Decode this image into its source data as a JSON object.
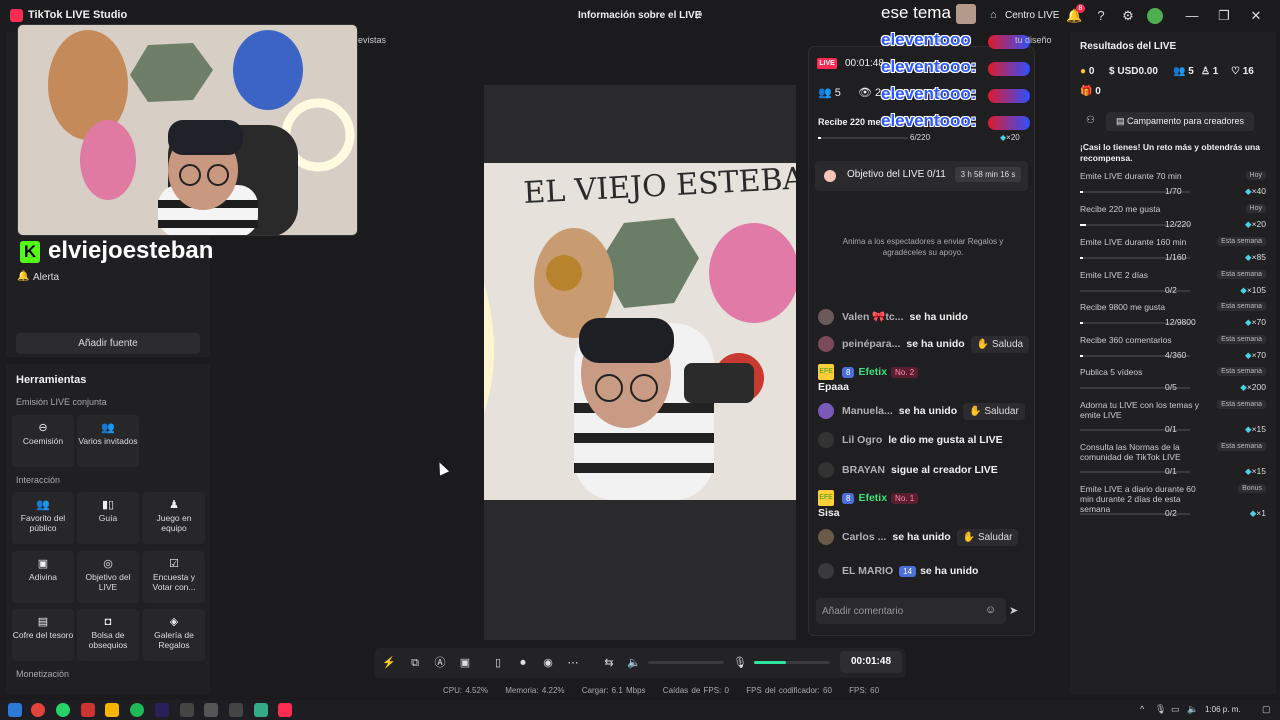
{
  "app": {
    "title": "TikTok LIVE Studio",
    "live_info": "Información sobre el LIVE",
    "centro_live": "Centro LIVE",
    "notif_count": "8"
  },
  "overlay": {
    "ese_tema": "ese tema",
    "eleventooo_1": "eleventooo",
    "eleventooo_2": "eleventooo:",
    "eleventooo_3": "eleventooo:",
    "eleventooo_4": "eleventooo:",
    "tu_diseno": "tu diseño",
    "entrevistas": "evistas"
  },
  "webcam": {
    "k_logo": "K",
    "name": "elviejoesteban"
  },
  "left": {
    "alerta": "Alerta",
    "add_source": "Añadir fuente",
    "tools_title": "Herramientas",
    "sections": {
      "joint": "Emisión LIVE conjunta",
      "interaction": "Interacción",
      "monetization": "Monetización"
    },
    "tools": {
      "coemision": "Coemisión",
      "varios": "Varios invitados",
      "favorito": "Favorito del público",
      "guia": "Guía",
      "juego": "Juego en equipo",
      "adivina": "Adivina",
      "objetivo": "Objetivo del LIVE",
      "encuesta": "Encuesta y Votar con...",
      "cofre": "Cofre del tesoro",
      "bolsa": "Bolsa de obsequios",
      "galeria": "Galería de Regalos"
    }
  },
  "controls": {
    "timer": "00:01:48",
    "mic_level": 0.42
  },
  "stats": {
    "cpu": "CPU: 4.52%",
    "mem": "Memoria: 4.22%",
    "load": "Cargar: 6.1 Mbps",
    "fps_drop": "Caídas de FPS: 0",
    "enc_fps": "FPS del codificador: 60",
    "fps": "FPS: 60"
  },
  "chat": {
    "live_badge": "LIVE",
    "timer": "00:01:48",
    "viewers": "5",
    "views": "2",
    "recibe": "Recibe 220 me",
    "recibe_count": "6/220",
    "recibe_reward": "×20",
    "recibe_progress": 0.027,
    "objetivo_label": "Objetivo del LIVE 0/11",
    "objetivo_time": "3 h 58 min 16 s",
    "anima": "Anima a los espectadores a enviar Regalos y agradéceles su apoyo.",
    "saludar": "Saludar",
    "saluda": "Saluda",
    "messages": [
      {
        "user": "Valen 🎀tc...",
        "text": "se ha unido"
      },
      {
        "user": "peinépara...",
        "text": "se ha unido"
      },
      {
        "user": "Efetix",
        "level": "8",
        "fan": "No. 2",
        "text": "Epaaa"
      },
      {
        "user": "Manuela...",
        "text": "se ha unido"
      },
      {
        "user": "Lil Ogro",
        "text": "le dio me gusta al LIVE"
      },
      {
        "user": "BRAYAN",
        "text": "sigue al creador LIVE"
      },
      {
        "user": "Efetix",
        "level": "8",
        "fan": "No. 1",
        "text": "Sisa"
      },
      {
        "user": "Carlos ...",
        "text": "se ha unido"
      },
      {
        "user": "EL MARIO",
        "level": "14",
        "text": "se ha unido"
      }
    ],
    "comment_placeholder": "Añadir comentario"
  },
  "results": {
    "title": "Resultados del LIVE",
    "stats": {
      "coins": "0",
      "usd": "USD0.00",
      "users": "5",
      "follows": "1",
      "likes": "16",
      "gifts": "0"
    },
    "campamento": "Campamento para creadores",
    "reto": "¡Casi lo tienes! Un reto más y obtendrás una recompensa.",
    "tasks": [
      {
        "name": "Emite LIVE durante 70 min",
        "tag": "Hoy",
        "count": "1/70",
        "reward": "×40",
        "progress": 0.014
      },
      {
        "name": "Recibe 220 me gusta",
        "tag": "Hoy",
        "count": "12/220",
        "reward": "×20",
        "progress": 0.055
      },
      {
        "name": "Emite LIVE durante 160 min",
        "tag": "Esta semana",
        "count": "1/160",
        "reward": "×85",
        "progress": 0.006
      },
      {
        "name": "Emite LIVE 2 días",
        "tag": "Esta semana",
        "count": "0/2",
        "reward": "×105",
        "progress": 0
      },
      {
        "name": "Recibe 9800 me gusta",
        "tag": "Esta semana",
        "count": "12/9800",
        "reward": "×70",
        "progress": 0.001
      },
      {
        "name": "Recibe 360 comentarios",
        "tag": "Esta semana",
        "count": "4/360",
        "reward": "×70",
        "progress": 0.011
      },
      {
        "name": "Publica 5 vídeos",
        "tag": "Esta semana",
        "count": "0/5",
        "reward": "×200",
        "progress": 0
      },
      {
        "name": "Adorna tu LIVE con los temas y emite LIVE",
        "tag": "Esta semana",
        "count": "0/1",
        "reward": "×15",
        "progress": 0
      },
      {
        "name": "Consulta las Normas de la comunidad de TikTok LIVE",
        "tag": "Esta semana",
        "count": "0/1",
        "reward": "×15",
        "progress": 0
      },
      {
        "name": "Emite LIVE a diario durante 60 min durante 2 días de esta semana",
        "tag": "Bonus",
        "count": "0/2",
        "reward": "×1",
        "progress": 0
      }
    ]
  },
  "taskbar": {
    "clock": "1:06 p. m."
  }
}
